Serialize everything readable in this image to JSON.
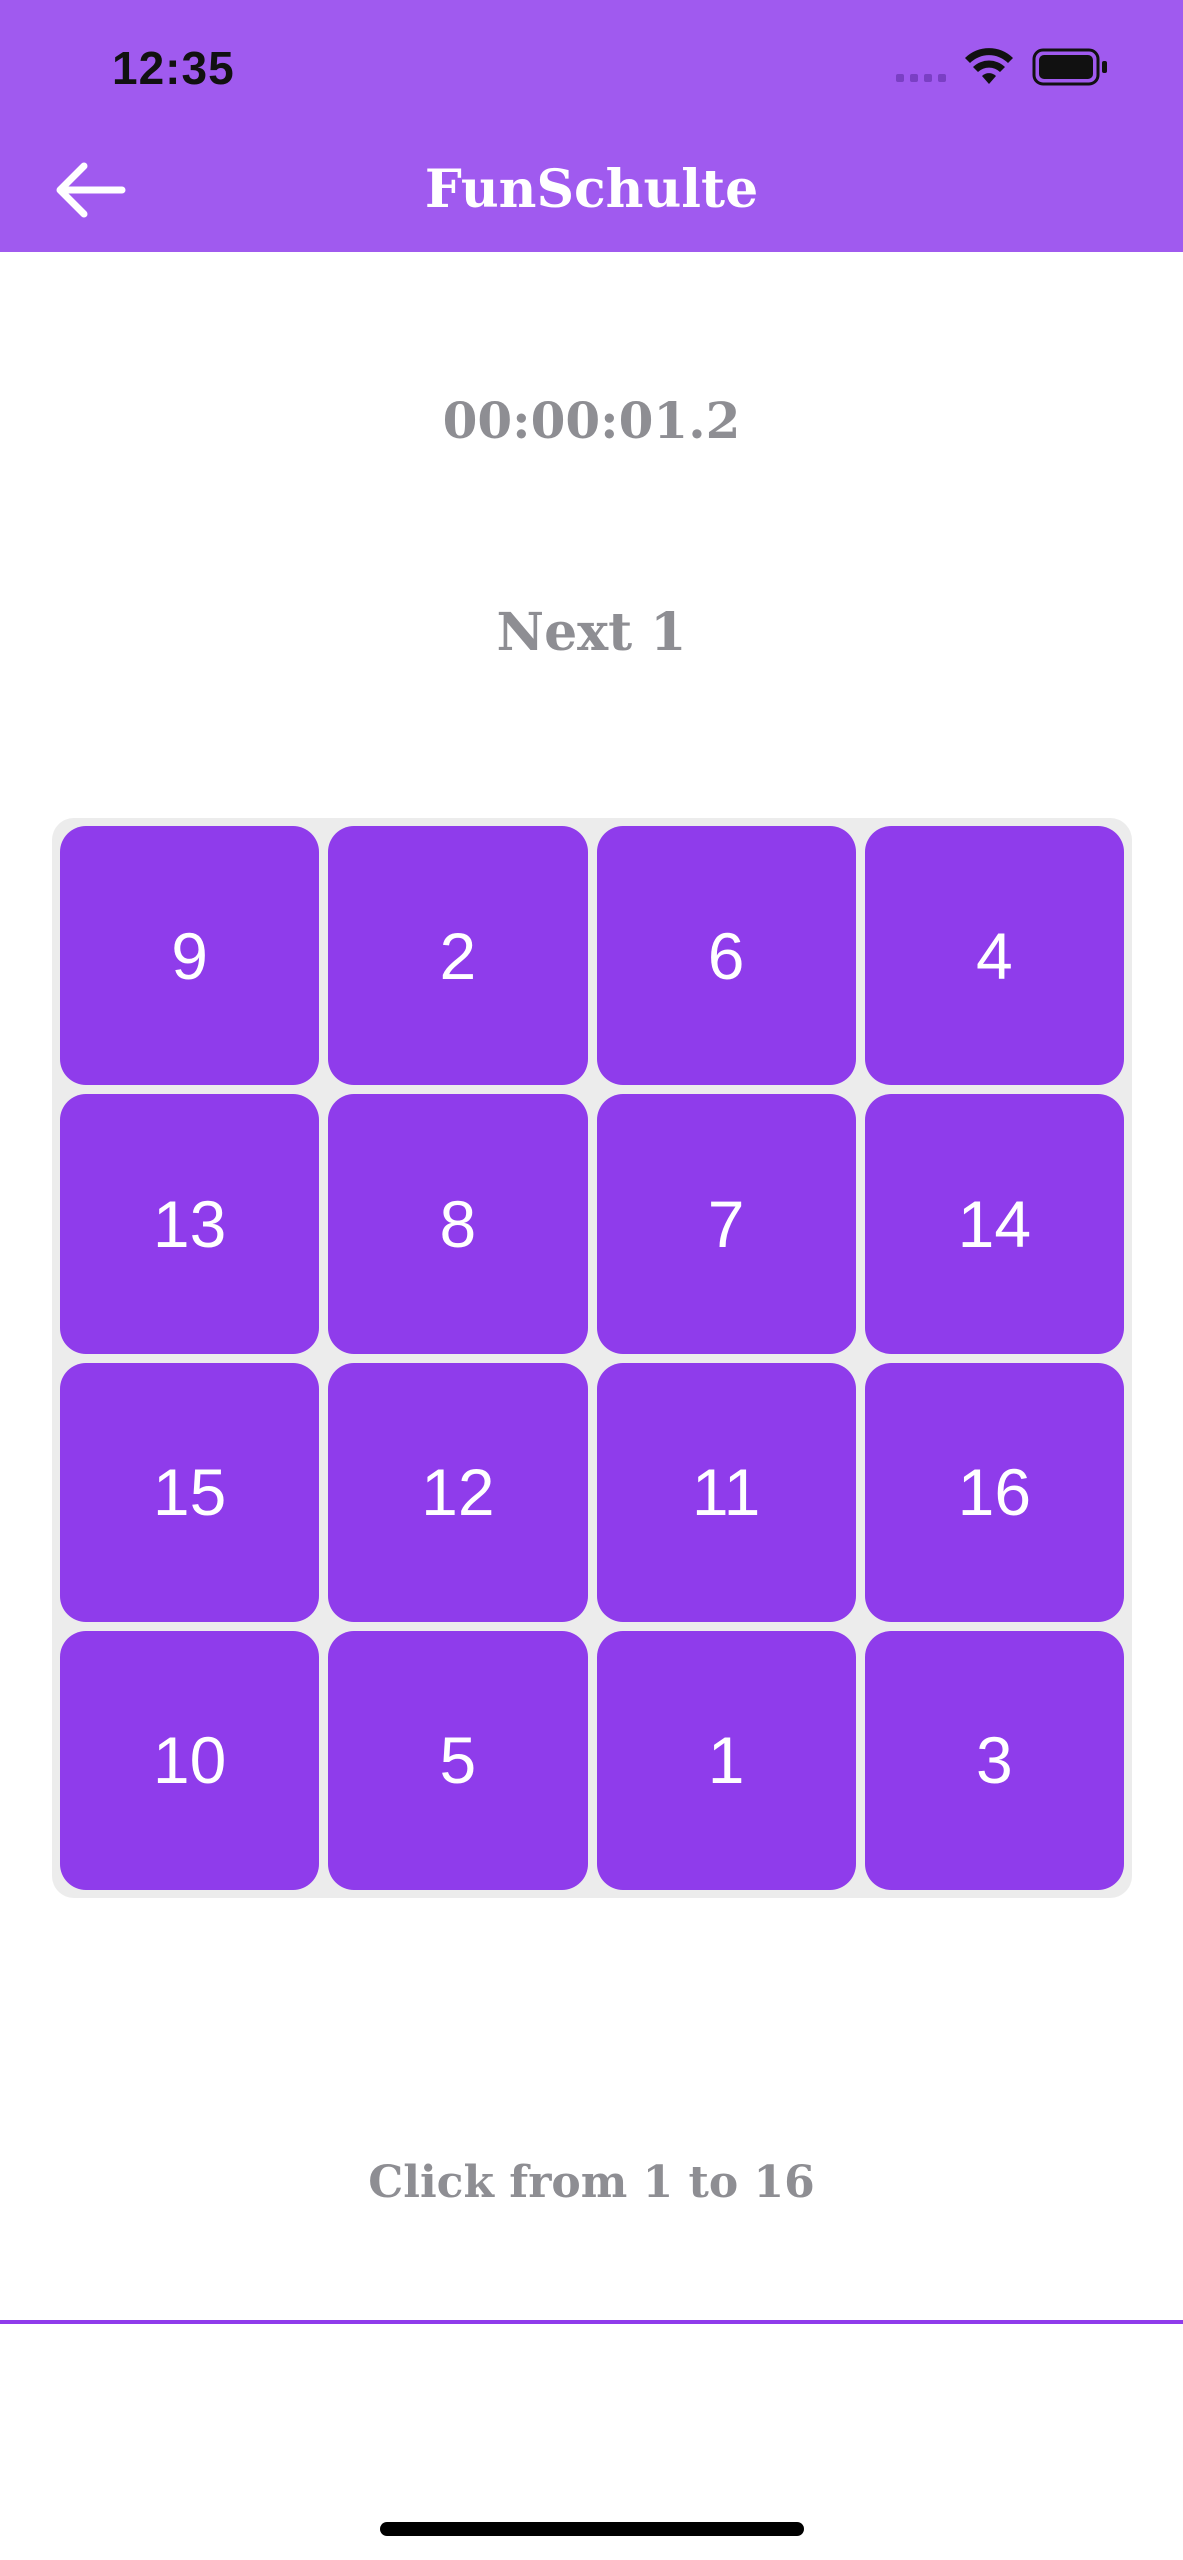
{
  "status_bar": {
    "time": "12:35",
    "icons": [
      "signal-icon",
      "wifi-icon",
      "battery-icon"
    ]
  },
  "header": {
    "title": "FunSchulte",
    "back_icon": "arrow-left-icon",
    "background": "#a05aef"
  },
  "game": {
    "timer": "00:00:01.2",
    "next_label": "Next",
    "next_value": "1",
    "tiles": [
      9,
      2,
      6,
      4,
      13,
      8,
      7,
      14,
      15,
      12,
      11,
      16,
      10,
      5,
      1,
      3
    ],
    "tile_color": "#8f3ceb",
    "instruction": "Click from 1 to 16"
  }
}
